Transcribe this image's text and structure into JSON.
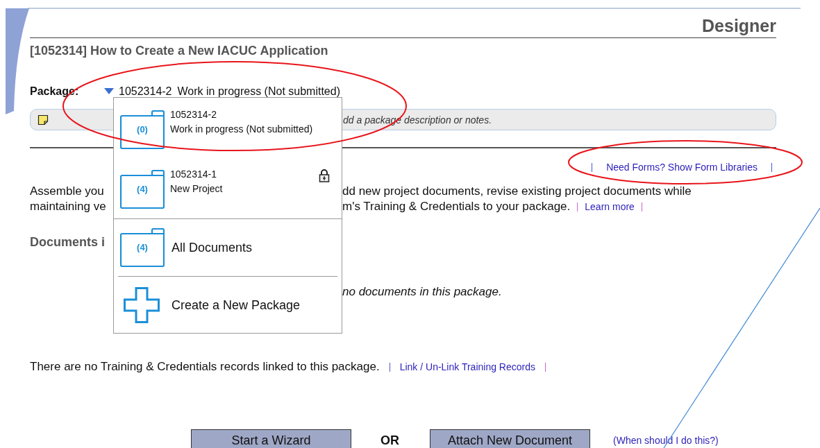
{
  "header": {
    "title": "Designer"
  },
  "study_title": "[1052314] How to Create a New IACUC Application",
  "package": {
    "label": "Package:",
    "number": "1052314-2",
    "status": "Work in progress (Not submitted)",
    "expanded": true
  },
  "notes": {
    "hint": "dd a package description or notes."
  },
  "form_libraries_link": "Need Forms? Show Form Libraries",
  "intro": {
    "line_1_left": "Assemble you",
    "line_1_right": "dd new project documents, revise existing project documents while",
    "line_2_left": "maintaining ve",
    "line_2_right": "m's Training & Credentials to your package.",
    "link": "Learn more"
  },
  "documents_heading": "Documents i",
  "empty_documents": "no documents in this package.",
  "training": {
    "text": "There are no Training & Credentials records linked to this package.",
    "link": "Link / Un-Link Training Records"
  },
  "actions": {
    "buttons": [
      "Start a Wizard",
      "Attach New Document"
    ],
    "separator": "OR",
    "help_link": "(When should I do this?)"
  },
  "dropdown": {
    "packages": [
      {
        "number": "1052314-2",
        "status": "Work in progress (Not submitted)",
        "count": "(0)",
        "locked": false
      },
      {
        "number": "1052314-1",
        "status": "New Project",
        "count": "(4)",
        "locked": true
      }
    ],
    "all_documents": {
      "count": "(4)",
      "label": "All Documents"
    },
    "create": {
      "label": "Create a New Package"
    }
  }
}
